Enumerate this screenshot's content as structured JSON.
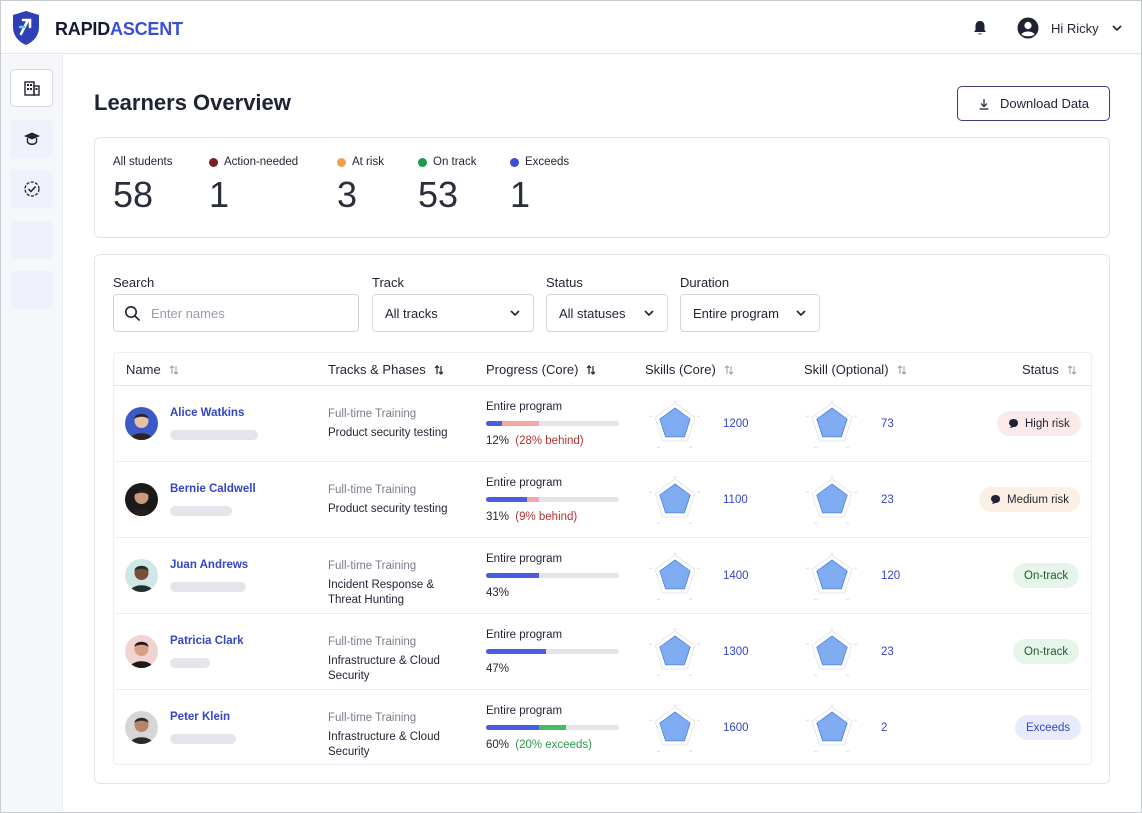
{
  "brand": {
    "part1": "RAPID",
    "part2": "ASCENT"
  },
  "header": {
    "greeting": "Hi Ricky"
  },
  "page": {
    "title": "Learners Overview",
    "download_label": "Download Data"
  },
  "stats": [
    {
      "label": "All students",
      "value": "58",
      "color": ""
    },
    {
      "label": "Action-needed",
      "value": "1",
      "color": "#7a1f24"
    },
    {
      "label": "At risk",
      "value": "3",
      "color": "#f0a050"
    },
    {
      "label": "On track",
      "value": "53",
      "color": "#1f9a4a"
    },
    {
      "label": "Exceeds",
      "value": "1",
      "color": "#3b4fd6"
    }
  ],
  "filters": {
    "search_label": "Search",
    "search_placeholder": "Enter names",
    "track_label": "Track",
    "track_value": "All tracks",
    "status_label": "Status",
    "status_value": "All statuses",
    "duration_label": "Duration",
    "duration_value": "Entire program"
  },
  "columns": {
    "name": "Name",
    "tracks": "Tracks & Phases",
    "progress": "Progress (Core)",
    "skills_core": "Skills (Core)",
    "skill_optional": "Skill (Optional)",
    "status": "Status"
  },
  "rows": [
    {
      "name": "Alice Watkins",
      "track": "Full-time Training",
      "phase": "Product security testing",
      "progress_title": "Entire program",
      "progress_pct": "12%",
      "progress_note": "(28% behind)",
      "progress_value": 0.12,
      "progress_extra": 0.28,
      "progress_extra_color": "#f2a7a7",
      "note_color": "#b33232",
      "skills_core": "1200",
      "skill_optional": "73",
      "status": "High risk",
      "status_bg": "#fbeaea",
      "status_icon": "chat-bubble-icon"
    },
    {
      "name": "Bernie Caldwell",
      "track": "Full-time Training",
      "phase": "Product security testing",
      "progress_title": "Entire program",
      "progress_pct": "31%",
      "progress_note": "(9% behind)",
      "progress_value": 0.31,
      "progress_extra": 0.09,
      "progress_extra_color": "#f2a7a7",
      "note_color": "#b33232",
      "skills_core": "1100",
      "skill_optional": "23",
      "status": "Medium risk",
      "status_bg": "#fbf0e3",
      "status_icon": "chat-bubble-icon"
    },
    {
      "name": "Juan Andrews",
      "track": "Full-time Training",
      "phase": "Incident Response & Threat Hunting",
      "progress_title": "Entire program",
      "progress_pct": "43%",
      "progress_note": "",
      "progress_value": 0.4,
      "progress_extra": 0,
      "progress_extra_color": "",
      "note_color": "",
      "skills_core": "1400",
      "skill_optional": "120",
      "status": "On-track",
      "status_bg": "#e6f5ea",
      "status_icon": ""
    },
    {
      "name": "Patricia Clark",
      "track": "Full-time Training",
      "phase": "Infrastructure & Cloud Security",
      "progress_title": "Entire program",
      "progress_pct": "47%",
      "progress_note": "",
      "progress_value": 0.45,
      "progress_extra": 0,
      "progress_extra_color": "",
      "note_color": "",
      "skills_core": "1300",
      "skill_optional": "23",
      "status": "On-track",
      "status_bg": "#e6f5ea",
      "status_icon": ""
    },
    {
      "name": "Peter Klein",
      "track": "Full-time Training",
      "phase": "Infrastructure & Cloud Security",
      "progress_title": "Entire program",
      "progress_pct": "60%",
      "progress_note": "(20% exceeds)",
      "progress_value": 0.4,
      "progress_extra": 0.2,
      "progress_extra_color": "#3fbf5f",
      "note_color": "#2a9a48",
      "skills_core": "1600",
      "skill_optional": "2",
      "status": "Exceeds",
      "status_bg": "#e8ebfb",
      "status_icon": ""
    }
  ],
  "colors": {
    "accent": "#3b4fd6",
    "progress": "#4a5ce0",
    "radar_fill": "#6a9df0"
  }
}
